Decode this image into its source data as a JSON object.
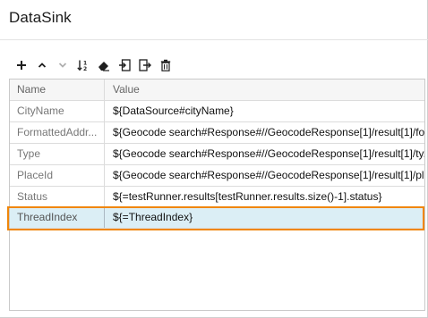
{
  "panel": {
    "title": "DataSink"
  },
  "toolbar": {
    "buttons": [
      {
        "icon": "add-icon",
        "enabled": true
      },
      {
        "icon": "move-up-icon",
        "enabled": true
      },
      {
        "icon": "move-down-icon",
        "enabled": false
      },
      {
        "icon": "sort-icon",
        "enabled": true
      },
      {
        "icon": "clear-icon",
        "enabled": true
      },
      {
        "icon": "import-icon",
        "enabled": true
      },
      {
        "icon": "export-icon",
        "enabled": true
      },
      {
        "icon": "delete-icon",
        "enabled": true
      }
    ]
  },
  "grid": {
    "columns": {
      "name": "Name",
      "value": "Value"
    },
    "rows": [
      {
        "name": "CityName",
        "value": "${DataSource#cityName}"
      },
      {
        "name": "FormattedAddr...",
        "value": "${Geocode search#Response#//GeocodeResponse[1]/result[1]/fo..."
      },
      {
        "name": "Type",
        "value": "${Geocode search#Response#//GeocodeResponse[1]/result[1]/ty..."
      },
      {
        "name": "PlaceId",
        "value": "${Geocode search#Response#//GeocodeResponse[1]/result[1]/pl..."
      },
      {
        "name": "Status",
        "value": "${=testRunner.results[testRunner.results.size()-1].status}"
      },
      {
        "name": "ThreadIndex",
        "value": "${=ThreadIndex}"
      }
    ],
    "selected_row": "ThreadIndex"
  },
  "colors": {
    "selection_border": "#f0860a",
    "selection_fill": "#dbeef5"
  }
}
